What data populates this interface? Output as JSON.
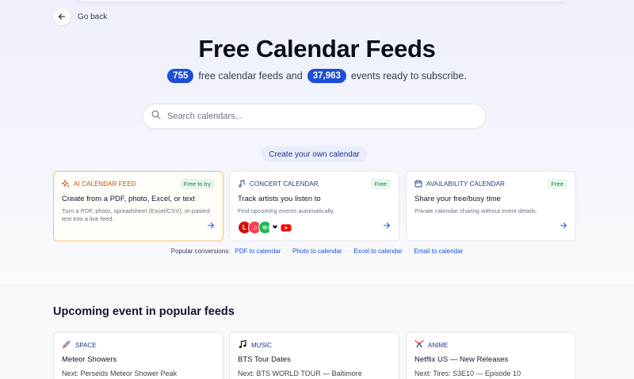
{
  "nav": {
    "back_label": "Go back"
  },
  "hero": {
    "title": "Free Calendar Feeds",
    "feeds_count": "755",
    "feeds_text": "free calendar feeds and",
    "events_count": "37,963",
    "events_text": "events ready to subscribe."
  },
  "search": {
    "placeholder": "Search calendars..."
  },
  "create_button": "Create your own calendar",
  "feature_cards": [
    {
      "icon": "sparkles-icon",
      "tag": "AI CALENDAR FEED",
      "badge": "Free to try",
      "title": "Create from a PDF, photo, Excel, or text",
      "description": "Turn a PDF, photo, spreadsheet (Excel/CSV), or pasted text into a live feed."
    },
    {
      "icon": "music-note-icon",
      "tag": "CONCERT CALENDAR",
      "badge": "Free",
      "title": "Track artists you listen to",
      "description": "Find upcoming events automatically.",
      "service_logos": [
        "lastfm-icon",
        "apple-music-icon",
        "spotify-icon",
        "tidal-icon",
        "youtube-icon"
      ]
    },
    {
      "icon": "calendar-icon",
      "tag": "AVAILABILITY CALENDAR",
      "badge": "Free",
      "title": "Share your free/busy time",
      "description": "Private calendar sharing without event details."
    }
  ],
  "conversions": {
    "label": "Popular conversions:",
    "links": [
      "PDF to calendar",
      "Photo to calendar",
      "Excel to calendar",
      "Email to calendar"
    ]
  },
  "upcoming": {
    "title": "Upcoming event in popular feeds",
    "cards": [
      {
        "icon": "rocket-icon",
        "tag": "SPACE",
        "title": "Meteor Showers",
        "next": "Next: Perseids Meteor Shower Peak"
      },
      {
        "icon": "music-note-icon",
        "tag": "MUSIC",
        "title": "BTS Tour Dates",
        "next": "Next: BTS WORLD TOUR — Baltimore"
      },
      {
        "icon": "anime-icon",
        "tag": "ANIME",
        "title": "Netflix US — New Releases",
        "next": "Next: Tires: S3E10 — Episode 10"
      }
    ]
  },
  "colors": {
    "accent": "#1d4ed8",
    "ai_border": "#f4c27a",
    "badge_green": "#15803d"
  }
}
